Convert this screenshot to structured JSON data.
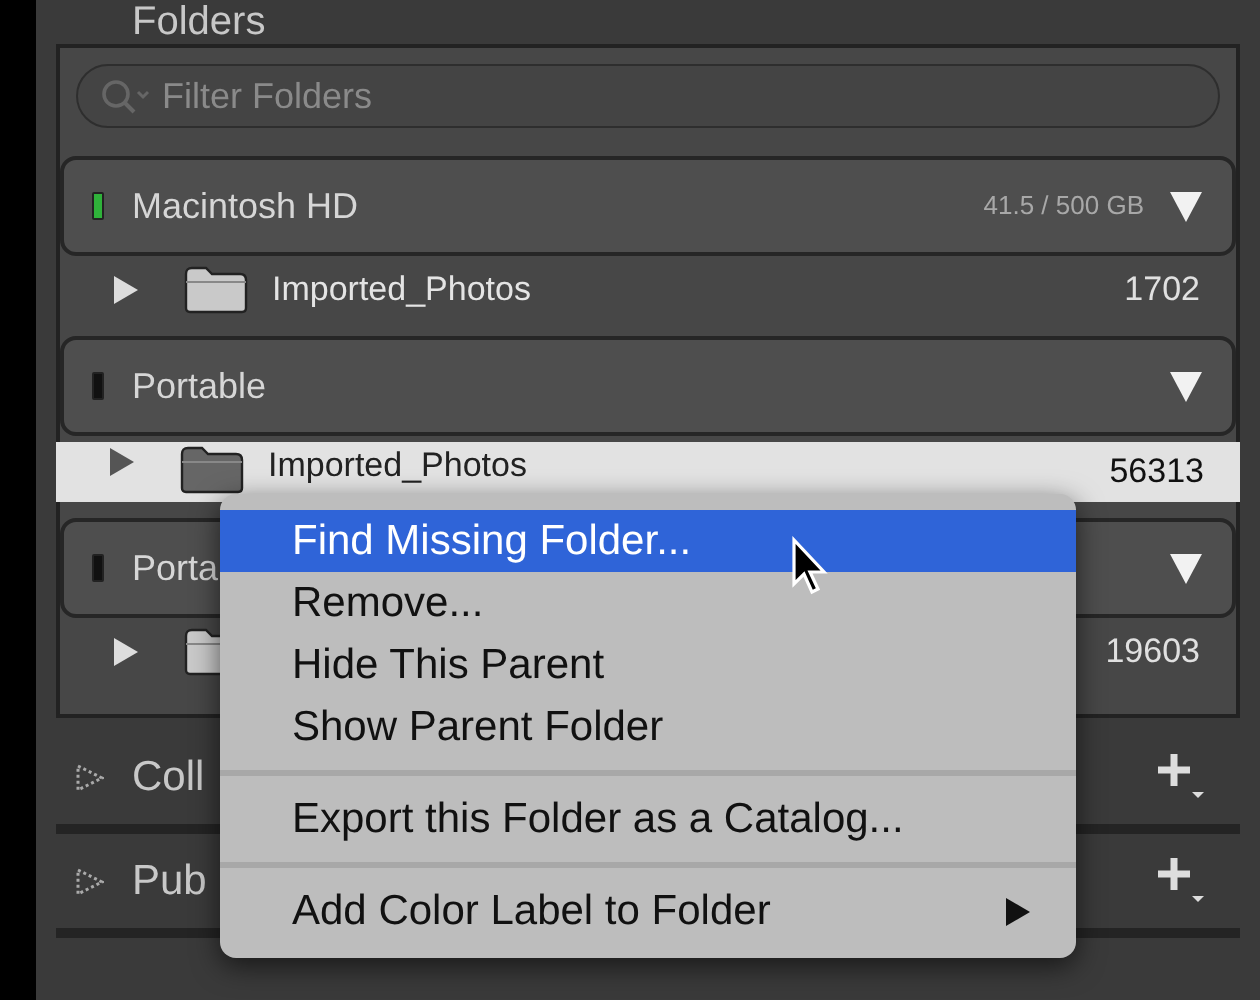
{
  "panel": {
    "title": "Folders"
  },
  "filter": {
    "placeholder": "Filter Folders"
  },
  "volumes": [
    {
      "name": "Macintosh HD",
      "info": "41.5 / 500 GB",
      "color": "#2fb23a",
      "expanded": true,
      "folders": [
        {
          "name": "Imported_Photos",
          "count": "1702",
          "selected": false
        }
      ]
    },
    {
      "name": "Portable",
      "color": "#111111",
      "expanded": true,
      "folders": [
        {
          "name": "Imported_Photos",
          "count": "56313",
          "selected": true
        }
      ]
    },
    {
      "name": "Porta",
      "color": "#111111",
      "expanded": true,
      "folders": [
        {
          "count": "19603",
          "selected": false
        }
      ]
    }
  ],
  "sections": [
    {
      "title": "Coll",
      "expanded": false
    },
    {
      "title": "Pub",
      "expanded": false
    }
  ],
  "context_menu": [
    {
      "kind": "item",
      "label": "Find Missing Folder...",
      "selected": true
    },
    {
      "kind": "item",
      "label": "Remove...",
      "selected": false
    },
    {
      "kind": "item",
      "label": "Hide This Parent",
      "selected": false
    },
    {
      "kind": "item",
      "label": "Show Parent Folder",
      "selected": false
    },
    {
      "kind": "separator"
    },
    {
      "kind": "item",
      "label": "Export this Folder as a Catalog...",
      "selected": false
    },
    {
      "kind": "separator"
    },
    {
      "kind": "submenu",
      "label": "Add Color Label to Folder",
      "selected": false
    }
  ]
}
